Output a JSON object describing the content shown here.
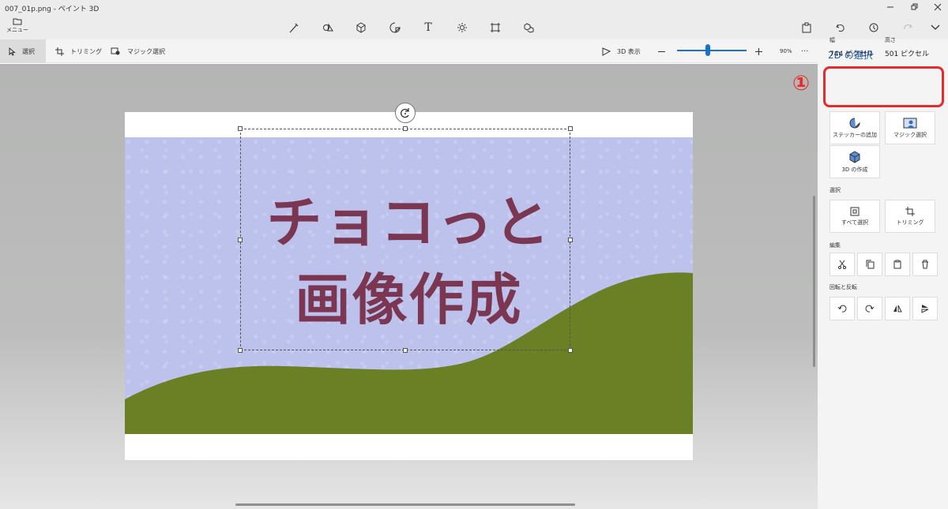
{
  "window": {
    "title": "007_01p.png - ペイント 3D",
    "menu_label": "メニュー"
  },
  "toolbar": {
    "tools": [
      {
        "name": "brushes-icon"
      },
      {
        "name": "2d-shapes-icon"
      },
      {
        "name": "3d-shapes-icon"
      },
      {
        "name": "stickers-icon"
      },
      {
        "name": "text-icon",
        "glyph": "T"
      },
      {
        "name": "effects-icon"
      },
      {
        "name": "canvas-icon"
      },
      {
        "name": "3d-library-icon"
      }
    ]
  },
  "options": {
    "select": "選択",
    "crop": "トリミング",
    "magic_select": "マジック選択",
    "view3d": "3D 表示",
    "zoom": "90%",
    "more": "···"
  },
  "canvas": {
    "line1": "チョコっと",
    "line2": "画像作成"
  },
  "panel": {
    "title": "2D の選択",
    "width_label": "幅",
    "width_value": "744 ピクセル",
    "height_label": "高さ",
    "height_value": "501 ピクセル",
    "sticker": "ステッカーの追加",
    "magic": "マジック選択",
    "make3d": "3D の作成",
    "select_section": "選択",
    "select_all": "すべて選択",
    "crop": "トリミング",
    "edit_section": "編集",
    "rotate_section": "回転と反転"
  },
  "annotation": "①",
  "colors": {
    "accent": "#1a73c9",
    "title_text": "#7b3752",
    "sky": "#bcc2ec",
    "hill": "#6b7f24",
    "highlight": "#e52b2b"
  }
}
